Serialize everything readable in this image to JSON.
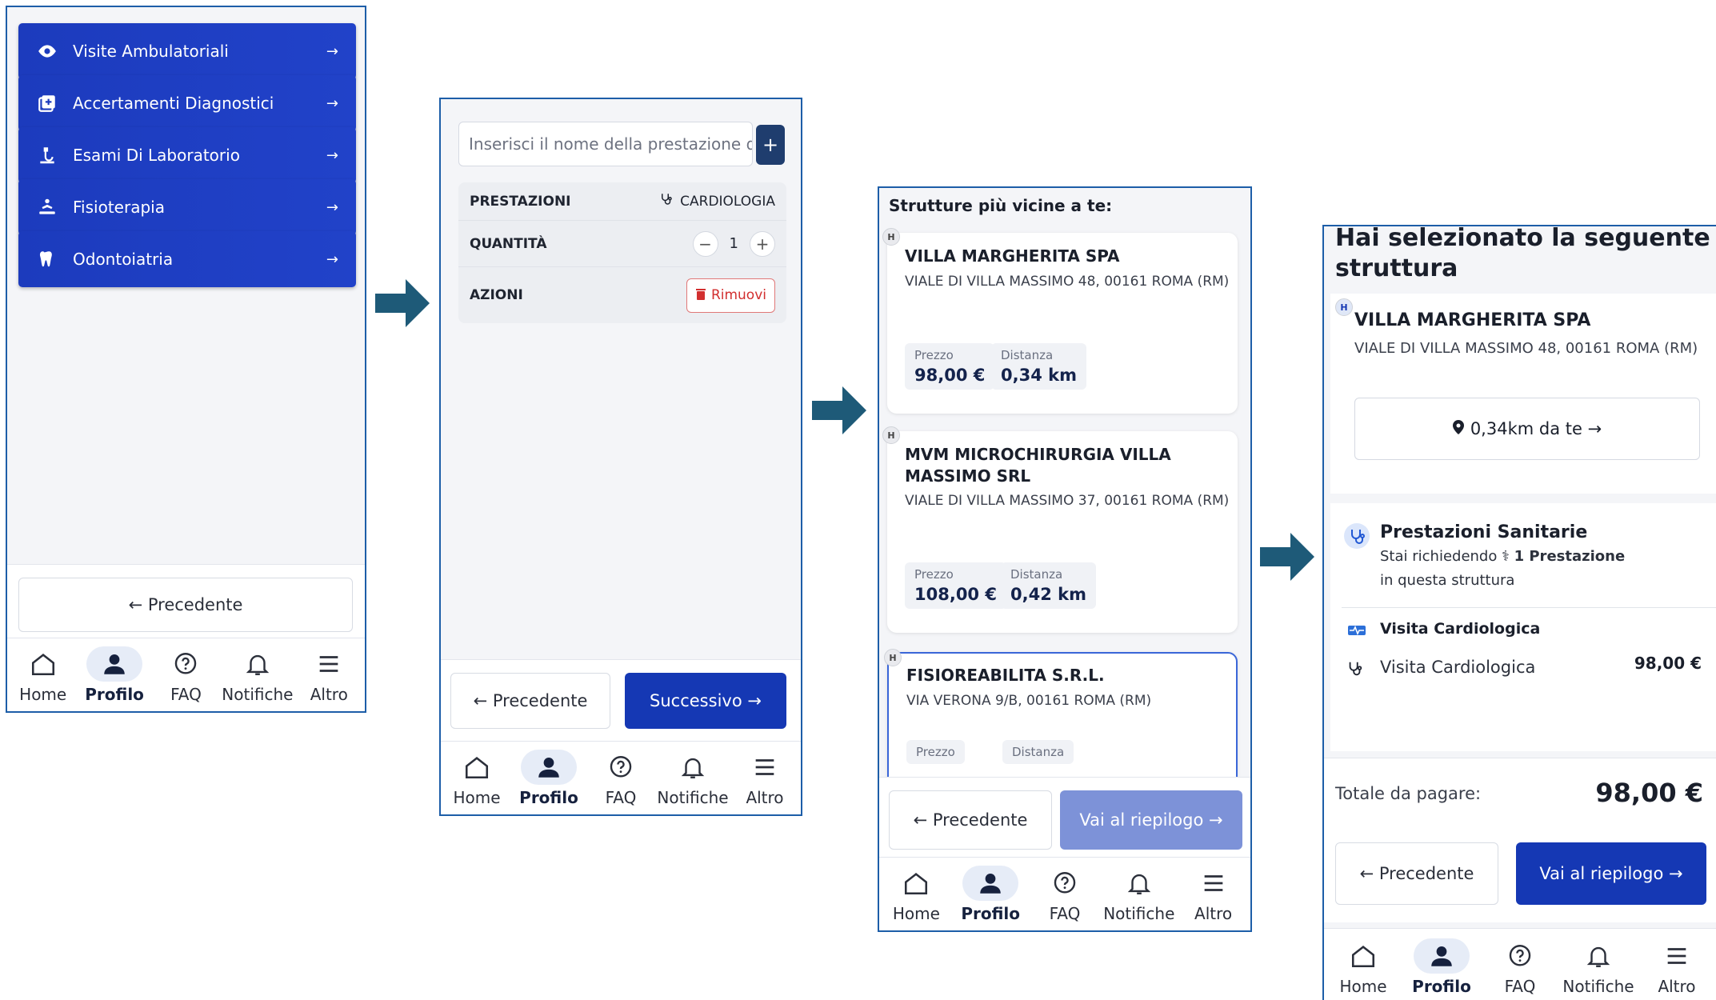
{
  "screen1": {
    "menu": [
      {
        "label": "Visite Ambulatoriali",
        "icon": "eye-icon"
      },
      {
        "label": "Accertamenti Diagnostici",
        "icon": "diagnostic-icon"
      },
      {
        "label": "Esami Di Laboratorio",
        "icon": "lab-icon"
      },
      {
        "label": "Fisioterapia",
        "icon": "physiotherapy-icon"
      },
      {
        "label": "Odontoiatria",
        "icon": "tooth-icon"
      }
    ],
    "chevron": "→",
    "prev_label": "← Precedente"
  },
  "screen2": {
    "search_placeholder": "Inserisci il nome della prestazione d",
    "plus": "+",
    "rows": {
      "prestazioni_label": "PRESTAZIONI",
      "prestazioni_value": "CARDIOLOGIA",
      "quantita_label": "QUANTITÀ",
      "quantita_value": "1",
      "minus": "−",
      "plus": "+",
      "azioni_label": "AZIONI",
      "remove_label": "Rimuovi"
    },
    "prev_label": "← Precedente",
    "next_label": "Successivo →"
  },
  "screen3": {
    "title": "Strutture più vicine a te:",
    "price_label": "Prezzo",
    "distance_label": "Distanza",
    "structures": [
      {
        "name": "VILLA MARGHERITA SPA",
        "address": "VIALE DI VILLA MASSIMO 48, 00161 ROMA (RM)",
        "price": "98,00 €",
        "distance": "0,34 km"
      },
      {
        "name": "MVM MICROCHIRURGIA VILLA MASSIMO SRL",
        "address": "VIALE DI VILLA MASSIMO 37, 00161 ROMA (RM)",
        "price": "108,00 €",
        "distance": "0,42 km"
      },
      {
        "name": "FISIOREABILITA S.R.L.",
        "address": "VIA VERONA 9/B, 00161 ROMA (RM)",
        "price": "",
        "distance": ""
      }
    ],
    "pin_letter": "H",
    "prev_label": "← Precedente",
    "next_label": "Vai al riepilogo →"
  },
  "screen4": {
    "title": "Hai selezionato la seguente struttura",
    "name": "VILLA MARGHERITA SPA",
    "address": "VIALE DI VILLA MASSIMO 48, 00161 ROMA (RM)",
    "distance_button": "0,34km da te →",
    "prest_title": "Prestazioni Sanitarie",
    "prest_sub_prefix": "Stai richiedendo",
    "prest_count": "1 Prestazione",
    "prest_sub_suffix": "in questa struttura",
    "category": "Visita Cardiologica",
    "item_name": "Visita Cardiologica",
    "item_price": "98,00 €",
    "total_label": "Totale da pagare:",
    "total_value": "98,00 €",
    "prev_label": "← Precedente",
    "next_label": "Vai al riepilogo →"
  },
  "nav": {
    "home": "Home",
    "profilo": "Profilo",
    "faq": "FAQ",
    "notifiche": "Notifiche",
    "altro": "Altro"
  },
  "colors": {
    "primary": "#1538b4",
    "accent_border": "#1d5ea8",
    "arrow": "#1e5a78",
    "danger": "#d22f2f"
  }
}
